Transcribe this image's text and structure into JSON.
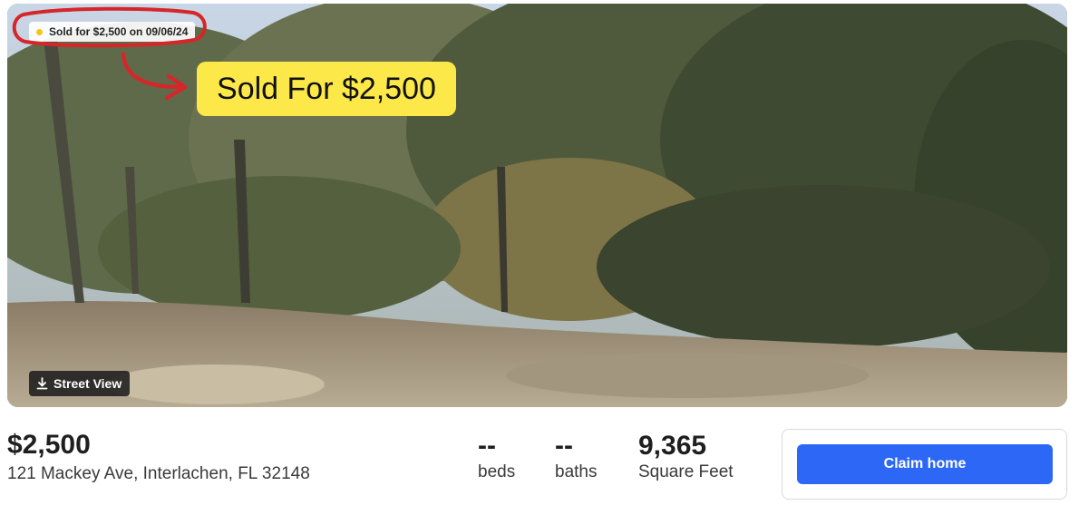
{
  "hero": {
    "sold_badge": "Sold for $2,500 on 09/06/24",
    "annotation_callout": "Sold For $2,500",
    "street_view_label": "Street View",
    "icons": {
      "sold_status": "yellow-dot-icon",
      "street_view": "download-icon"
    },
    "colors": {
      "badge_dot": "#f5c518",
      "callout_bg": "#fde84a",
      "annotation_stroke": "#d6262a"
    }
  },
  "listing": {
    "price": "$2,500",
    "address": "121 Mackey Ave, Interlachen, FL 32148"
  },
  "stats": [
    {
      "value": "--",
      "label": "beds"
    },
    {
      "value": "--",
      "label": "baths"
    },
    {
      "value": "9,365",
      "label": "Square Feet"
    }
  ],
  "claim": {
    "button_label": "Claim home",
    "button_color": "#2c68f5"
  }
}
